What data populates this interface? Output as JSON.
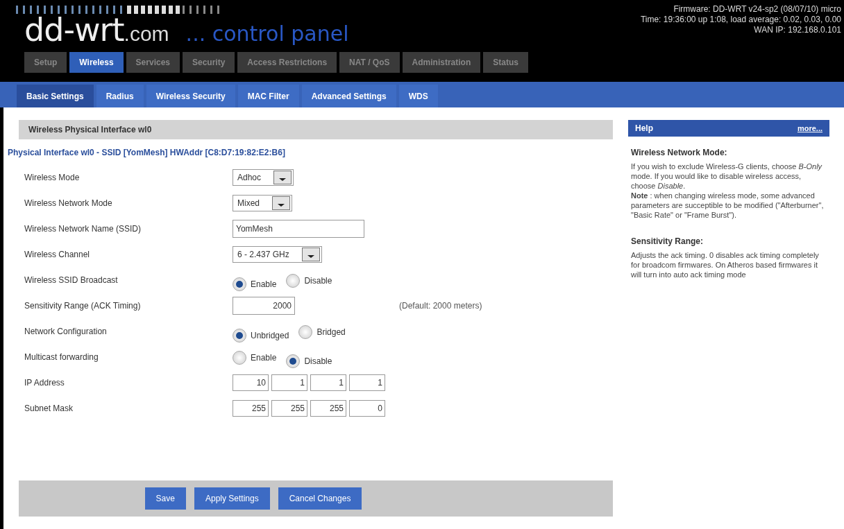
{
  "header": {
    "logo": {
      "brand": "dd-wrt",
      "tld": ".com",
      "tagline": "... control panel"
    },
    "info": [
      "Firmware: DD-WRT v24-sp2 (08/07/10) micro",
      "Time: 19:36:00 up 1:08, load average: 0.02, 0.03, 0.00",
      "WAN IP: 192.168.0.101"
    ]
  },
  "tabs": [
    {
      "label": "Setup",
      "selected": false
    },
    {
      "label": "Wireless",
      "selected": true
    },
    {
      "label": "Services",
      "selected": false
    },
    {
      "label": "Security",
      "selected": false
    },
    {
      "label": "Access Restrictions",
      "selected": false
    },
    {
      "label": "NAT / QoS",
      "selected": false
    },
    {
      "label": "Administration",
      "selected": false
    },
    {
      "label": "Status",
      "selected": false
    }
  ],
  "subtabs": [
    {
      "label": "Basic Settings",
      "selected": true
    },
    {
      "label": "Radius",
      "selected": false
    },
    {
      "label": "Wireless Security",
      "selected": false
    },
    {
      "label": "MAC Filter",
      "selected": false
    },
    {
      "label": "Advanced Settings",
      "selected": false
    },
    {
      "label": "WDS",
      "selected": false
    }
  ],
  "section_title": "Wireless Physical Interface wl0",
  "interface_title": "Physical Interface wl0 - SSID [YomMesh] HWAddr [C8:D7:19:82:E2:B6]",
  "fields": [
    {
      "kind": "select",
      "label": "Wireless Mode",
      "value": "Adhoc"
    },
    {
      "kind": "select",
      "label": "Wireless Network Mode",
      "value": "Mixed"
    },
    {
      "kind": "text",
      "label": "Wireless Network Name (SSID)",
      "value": "YomMesh"
    },
    {
      "kind": "select",
      "label": "Wireless Channel",
      "value": "6 - 2.437 GHz"
    },
    {
      "kind": "radio",
      "label": "Wireless SSID Broadcast",
      "options": [
        {
          "label": "Enable",
          "selected": true
        },
        {
          "label": "Disable",
          "selected": false
        }
      ]
    },
    {
      "kind": "number",
      "label": "Sensitivity Range (ACK Timing)",
      "value": "2000",
      "note": "(Default: 2000 meters)"
    },
    {
      "kind": "radio",
      "label": "Network Configuration",
      "options": [
        {
          "label": "Unbridged",
          "selected": true
        },
        {
          "label": "Bridged",
          "selected": false
        }
      ]
    },
    {
      "kind": "radio",
      "label": "Multicast forwarding",
      "options": [
        {
          "label": "Enable",
          "selected": false
        },
        {
          "label": "Disable",
          "selected": true
        }
      ]
    },
    {
      "kind": "ip",
      "label": "IP Address",
      "octets": [
        "10",
        "1",
        "1",
        "1"
      ]
    },
    {
      "kind": "ip",
      "label": "Subnet Mask",
      "octets": [
        "255",
        "255",
        "255",
        "0"
      ]
    }
  ],
  "buttons": [
    "Save",
    "Apply Settings",
    "Cancel Changes"
  ],
  "help": {
    "title": "Help",
    "more": "more...",
    "sections": [
      {
        "heading": "Wireless Network Mode:",
        "paragraphs": [
          "If you wish to exclude Wireless-G clients, choose *B-Only* mode. If you would like to disable wireless access, choose *Disable*.",
          "**Note** : when changing wireless mode, some advanced parameters are succeptible to be modified (\"Afterburner\", \"Basic Rate\" or \"Frame Burst\")."
        ]
      },
      {
        "heading": "Sensitivity Range:",
        "paragraphs": [
          "Adjusts the ack timing. 0 disables ack timing completely for broadcom firmwares. On Atheros based firmwares it will turn into auto ack timing mode"
        ]
      }
    ]
  }
}
